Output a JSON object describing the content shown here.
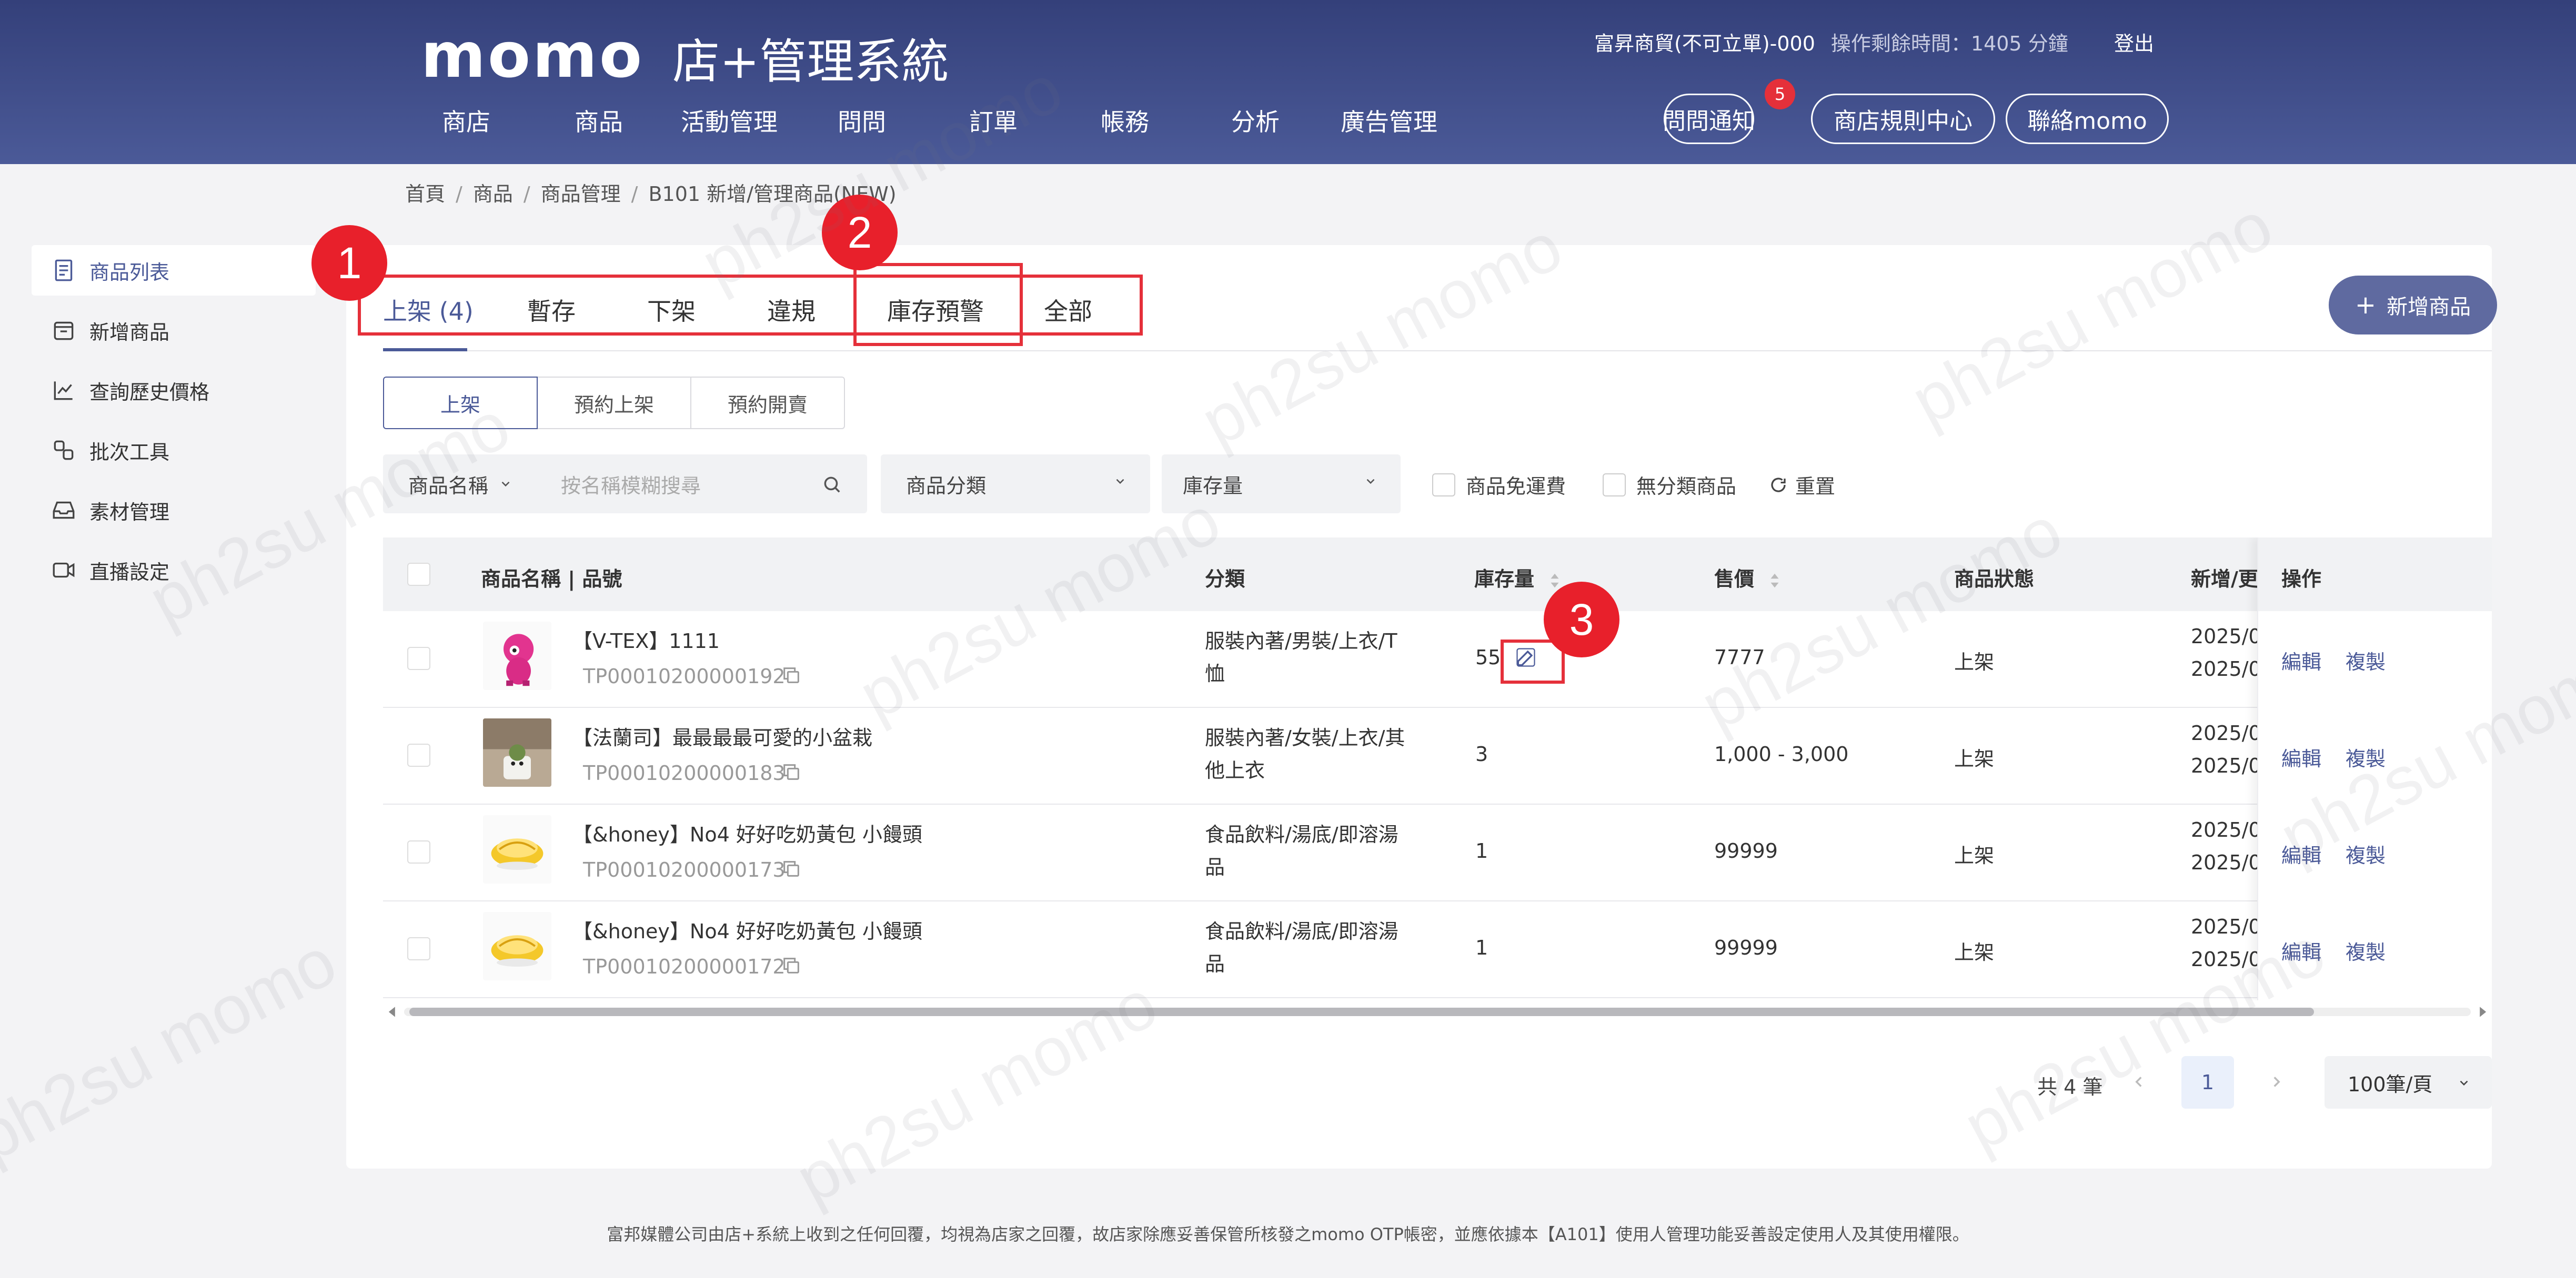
{
  "header": {
    "logo": "momo",
    "system_title": "店+管理系統",
    "nav": [
      "商店",
      "商品",
      "活動管理",
      "問問",
      "訂單",
      "帳務",
      "分析",
      "廣告管理"
    ],
    "user": "富昇商貿(不可立單)-000",
    "session_time": "操作剩餘時間：1405 分鐘",
    "logout": "登出",
    "pills": {
      "questions": "問問通知",
      "questions_badge": "5",
      "rules": "商店規則中心",
      "contact": "聯絡momo"
    }
  },
  "breadcrumb": [
    "首頁",
    "商品",
    "商品管理",
    "B101 新增/管理商品(NEW)"
  ],
  "sidebar": {
    "items": [
      {
        "label": "商品列表",
        "icon": "list-icon"
      },
      {
        "label": "新增商品",
        "icon": "box-icon"
      },
      {
        "label": "查詢歷史價格",
        "icon": "chart-icon"
      },
      {
        "label": "批次工具",
        "icon": "tools-icon"
      },
      {
        "label": "素材管理",
        "icon": "inbox-icon"
      },
      {
        "label": "直播設定",
        "icon": "video-icon"
      }
    ]
  },
  "tabs": [
    "上架 (4)",
    "暫存",
    "下架",
    "違規",
    "庫存預警",
    "全部"
  ],
  "add_button": "新增商品",
  "subtabs": [
    "上架",
    "預約上架",
    "預約開賣"
  ],
  "filters": {
    "name_select": "商品名稱",
    "search_placeholder": "按名稱模糊搜尋",
    "category": "商品分類",
    "stock": "庫存量",
    "free_shipping": "商品免運費",
    "uncategorized": "無分類商品",
    "reset": "重置"
  },
  "table": {
    "headers": {
      "name": "商品名稱 | 品號",
      "category": "分類",
      "stock": "庫存量",
      "price": "售價",
      "status": "商品狀態",
      "date": "新增/更",
      "ops": "操作"
    },
    "rows": [
      {
        "name": "【V-TEX】1111",
        "sku": "TP00010200000192",
        "cat1": "服裝內著/男裝/上衣/T",
        "cat2": "恤",
        "stock": "55",
        "price": "7777",
        "status": "上架",
        "d1": "2025/0",
        "d2": "2025/0",
        "edit": "編輯",
        "copy": "複製"
      },
      {
        "name": "【法蘭司】最最最最可愛的小盆栽",
        "sku": "TP00010200000183",
        "cat1": "服裝內著/女裝/上衣/其",
        "cat2": "他上衣",
        "stock": "3",
        "price": "1,000 - 3,000",
        "status": "上架",
        "d1": "2025/0",
        "d2": "2025/0",
        "edit": "編輯",
        "copy": "複製"
      },
      {
        "name": "【&honey】No4 好好吃奶黃包 小饅頭",
        "sku": "TP00010200000173",
        "cat1": "食品飲料/湯底/即溶湯",
        "cat2": "品",
        "stock": "1",
        "price": "99999",
        "status": "上架",
        "d1": "2025/0",
        "d2": "2025/0",
        "edit": "編輯",
        "copy": "複製"
      },
      {
        "name": "【&honey】No4 好好吃奶黃包 小饅頭",
        "sku": "TP00010200000172",
        "cat1": "食品飲料/湯底/即溶湯",
        "cat2": "品",
        "stock": "1",
        "price": "99999",
        "status": "上架",
        "d1": "2025/0",
        "d2": "2025/0",
        "edit": "編輯",
        "copy": "複製"
      }
    ]
  },
  "pagination": {
    "total": "共 4 筆",
    "page": "1",
    "page_size": "100筆/頁"
  },
  "footer": "富邦媒體公司由店+系統上收到之任何回覆，均視為店家之回覆，故店家除應妥善保管所核發之momo OTP帳密，並應依據本【A101】使用人管理功能妥善設定使用人及其使用權限。",
  "annotations": [
    "1",
    "2",
    "3"
  ],
  "watermark": "ph2su momo",
  "colors": {
    "brand": "#4b5a98",
    "annotation": "#e5303a"
  }
}
